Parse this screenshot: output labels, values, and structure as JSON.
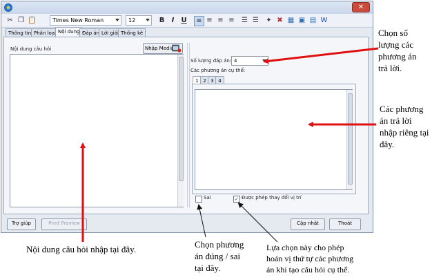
{
  "toolbar": {
    "font_name": "Times New Roman",
    "font_size": "12"
  },
  "tabs": [
    "Thông tin",
    "Phân loại",
    "Nội dung",
    "Đáp án",
    "Lời giải",
    "Thống kê"
  ],
  "question": {
    "label": "Nội dung câu hỏi",
    "media_button": "Nhập Media"
  },
  "answers": {
    "count_label": "Số lượng đáp án:",
    "count_value": "4",
    "options_label": "Các phương án cụ thể:",
    "option_tabs": [
      "1",
      "2",
      "3",
      "4"
    ],
    "sai_label": "Sai",
    "permute_label": "Được phép thay đổi vị trí",
    "permute_checked": true
  },
  "footer": {
    "help_button": "Trợ giúp",
    "print_button": "Print Preview",
    "update_button": "Cập nhật",
    "exit_button": "Thoát"
  },
  "annotations": {
    "count": [
      "Chọn số",
      "lượng các",
      "phương án",
      "trả lời."
    ],
    "options": [
      "Các phương",
      "án trả lời",
      "nhập riêng tại",
      "đây."
    ],
    "question": [
      "Nội dung câu hỏi nhập tại đây."
    ],
    "correct": [
      "Chọn phương",
      "án đúng / sai",
      "tại đây."
    ],
    "permute": [
      "Lựa chọn này cho phép",
      "hoán vị thứ tự các phương",
      "án khi tạo câu hỏi cụ thể."
    ]
  },
  "colors": {
    "arrow": "#e01010",
    "window_bg": "#e5e9f0"
  }
}
